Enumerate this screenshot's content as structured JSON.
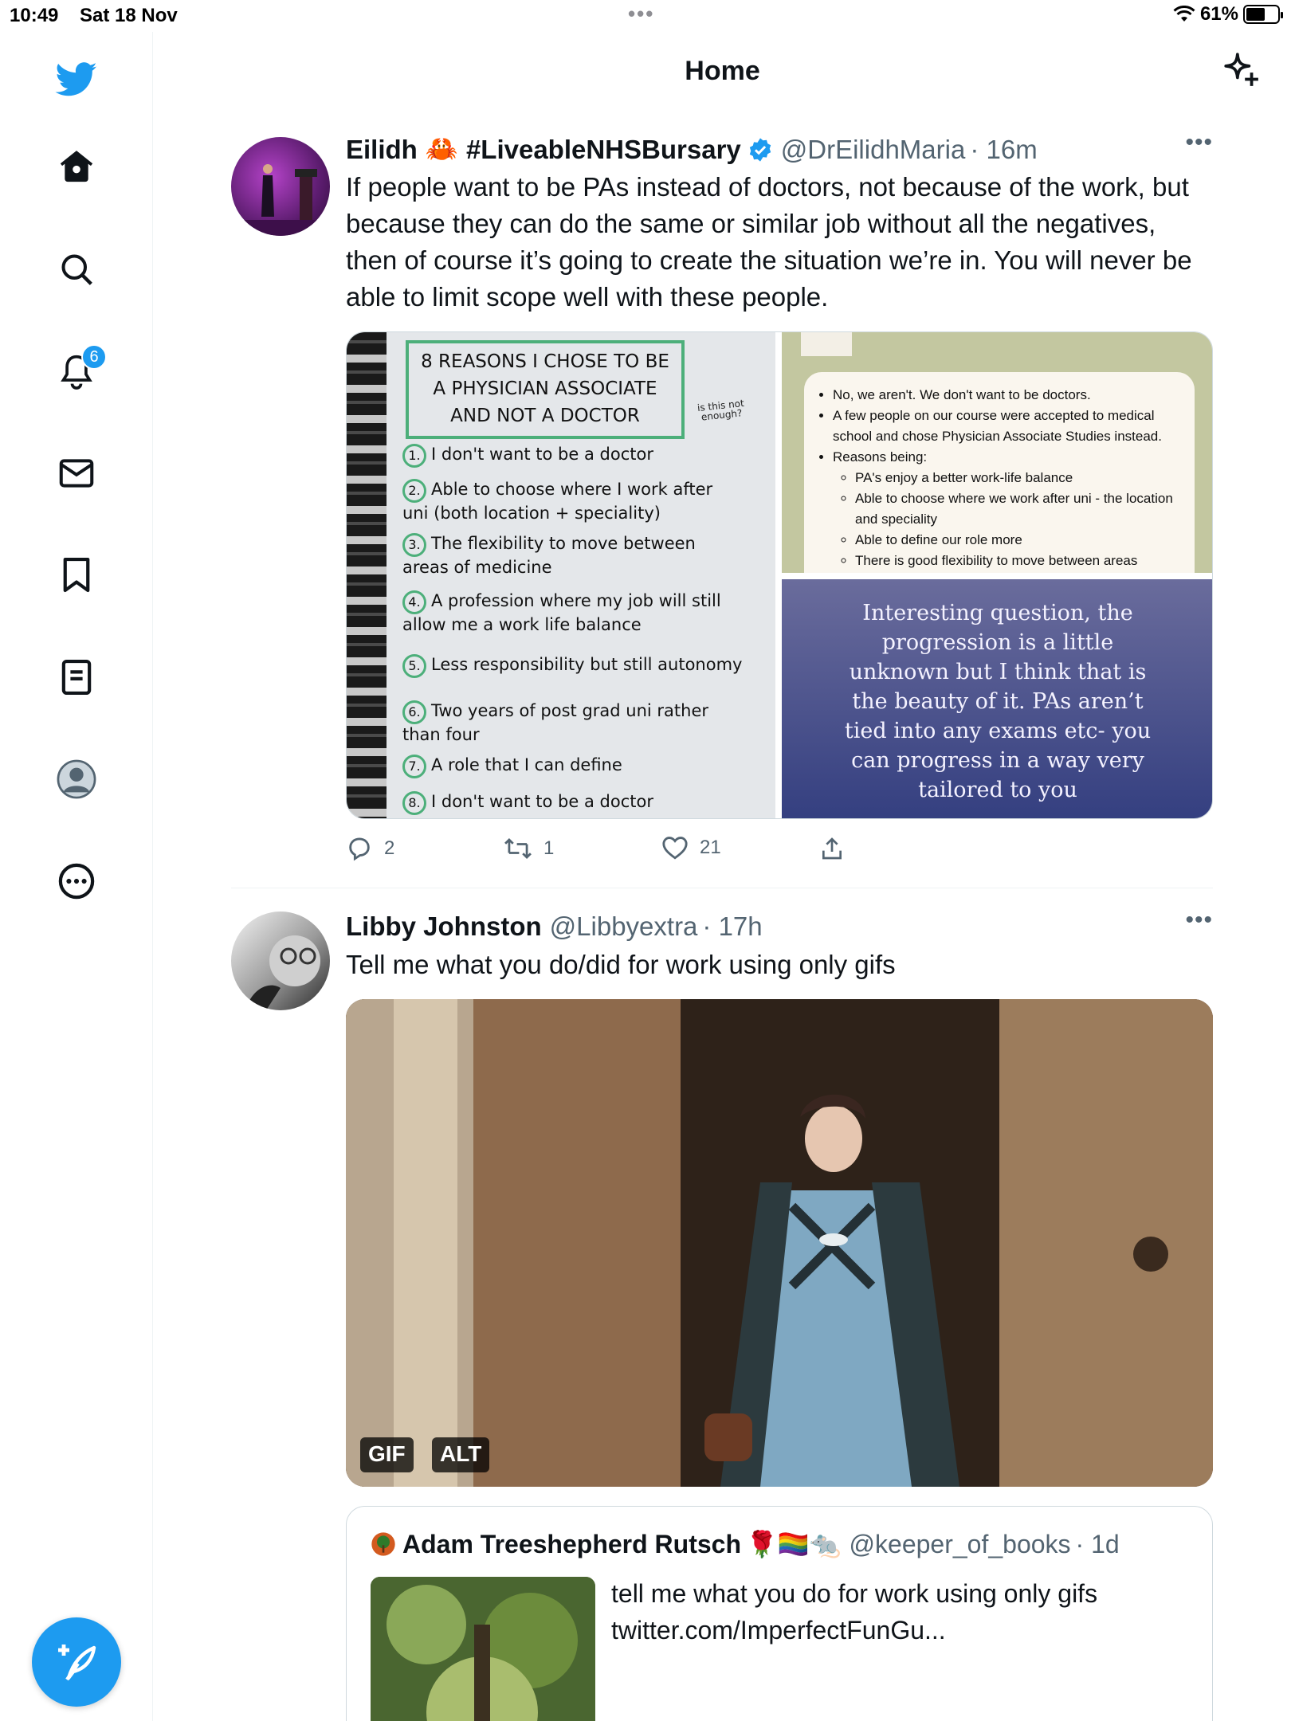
{
  "status_bar": {
    "time": "10:49",
    "date": "Sat 18 Nov",
    "battery": "61%",
    "battery_level": 0.61
  },
  "header": {
    "title": "Home"
  },
  "sidebar": {
    "items": [
      {
        "icon": "bird-logo-icon"
      },
      {
        "icon": "home-icon"
      },
      {
        "icon": "search-icon"
      },
      {
        "icon": "notifications-bell-icon",
        "badge": "6"
      },
      {
        "icon": "messages-envelope-icon"
      },
      {
        "icon": "bookmark-icon"
      },
      {
        "icon": "lists-icon"
      },
      {
        "icon": "profile-icon"
      },
      {
        "icon": "more-circle-icon"
      }
    ],
    "compose_icon": "compose-feather-icon"
  },
  "tweets": [
    {
      "name": "Eilidh",
      "name_emoji": "🦀",
      "name_tag": "#LiveableNHSBursary",
      "verified": true,
      "handle": "@DrEilidhMaria",
      "time": "· 16m",
      "text": "If people want to be PAs instead of doctors, not because of the work, but because they can do the same or similar job without all the negatives, then of course it’s going to create the situation we’re in. You will never be able to limit scope well with these people.",
      "media": {
        "notebook": {
          "title_lines": [
            "8 REASONS I CHOSE TO BE",
            "A PHYSICIAN ASSOCIATE",
            "AND NOT A DOCTOR"
          ],
          "side_note": "is this not enough?",
          "items": [
            {
              "n": "1.",
              "text": "I don't want to be a doctor"
            },
            {
              "n": "2.",
              "text": "Able to choose where I work after uni (both location + speciality)"
            },
            {
              "n": "3.",
              "text": "The flexibility to move between areas of medicine"
            },
            {
              "n": "4.",
              "text": "A profession where my job will still allow me a work life balance"
            },
            {
              "n": "5.",
              "text": "Less responsibility but still autonomy"
            },
            {
              "n": "6.",
              "text": "Two years of post grad uni rather than four"
            },
            {
              "n": "7.",
              "text": "A role that I can define"
            },
            {
              "n": "8.",
              "text": "I don't want to be a doctor"
            }
          ]
        },
        "insta_card": {
          "bullets": [
            "No, we aren't. We don't want to be doctors.",
            "A few people on our course were accepted to medical school and chose Physician Associate Studies instead.",
            "Reasons being:"
          ],
          "sub_bullets": [
            "PA's enjoy a better work-life balance",
            "Able to choose where we work after uni - the location and speciality",
            "Able to define our role more",
            "There is good flexibility to move between areas"
          ]
        },
        "quote_image_text": "Interesting question, the progression is a little unknown but I think that is the beauty of it. PAs aren’t tied into any exams etc- you can progress in a way very tailored to you"
      },
      "actions": {
        "replies": "2",
        "retweets": "1",
        "likes": "21"
      }
    },
    {
      "name": "Libby Johnston",
      "handle": "@Libbyextra",
      "time": "· 17h",
      "text": "Tell me what you do/did for work using only gifs",
      "gif_badges": [
        "GIF",
        "ALT"
      ],
      "quoted": {
        "name": "Adam Treeshepherd Rutsch",
        "name_emojis": "🌹🏳️‍🌈🐀",
        "handle": "@keeper_of_books",
        "time": "· 1d",
        "text_line1": "tell me what you do for work using only gifs",
        "text_line2": "twitter.com/ImperfectFunGu..."
      }
    }
  ],
  "colors": {
    "accent": "#1d9bf0",
    "text": "#0f1419",
    "secondary": "#536471"
  }
}
